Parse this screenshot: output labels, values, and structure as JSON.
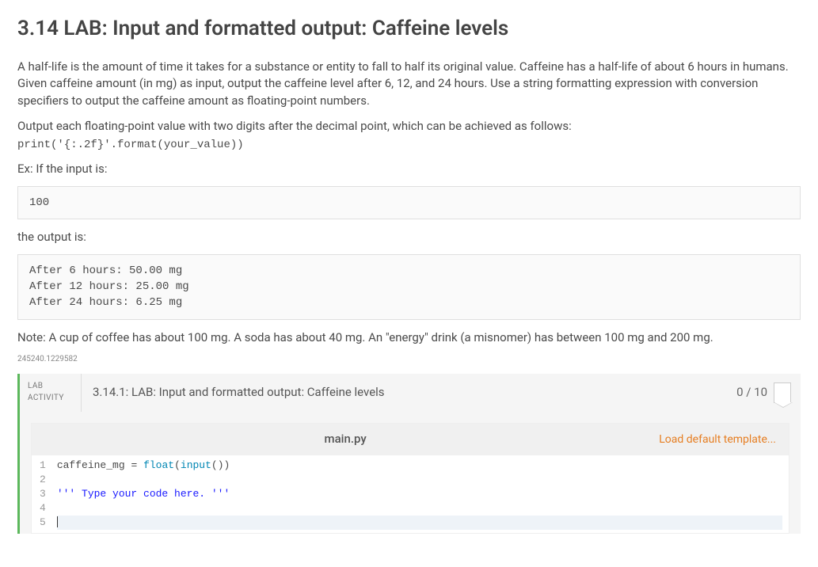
{
  "title": "3.14 LAB: Input and formatted output: Caffeine levels",
  "intro_p1": "A half-life is the amount of time it takes for a substance or entity to fall to half its original value. Caffeine has a half-life of about 6 hours in humans. Given caffeine amount (in mg) as input, output the caffeine level after 6, 12, and 24 hours. Use a string formatting expression with conversion specifiers to output the caffeine amount as floating-point numbers.",
  "intro_p2": "Output each floating-point value with two digits after the decimal point, which can be achieved as follows:",
  "print_example": "print('{:.2f}'.format(your_value))",
  "ex_label": "Ex: If the input is:",
  "input_block": "100",
  "output_label": "the output is:",
  "output_block": "After 6 hours: 50.00 mg\nAfter 12 hours: 25.00 mg\nAfter 24 hours: 6.25 mg",
  "note": "Note: A cup of coffee has about 100 mg. A soda has about 40 mg. An \"energy\" drink (a misnomer) has between 100 mg and 200 mg.",
  "hash_id": "245240.1229582",
  "lab": {
    "tag1": "LAB",
    "tag2": "ACTIVITY",
    "title": "3.14.1: LAB: Input and formatted output: Caffeine levels",
    "score": "0 / 10",
    "filename": "main.py",
    "load_template": "Load default template...",
    "gutter": "1\n2\n3\n4\n5",
    "code": {
      "l1a": "caffeine_mg ",
      "l1b": "=",
      "l1c": " ",
      "l1d": "float",
      "l1e": "(",
      "l1f": "input",
      "l1g": "())",
      "l3a": "''' Type your code here. '''"
    }
  }
}
